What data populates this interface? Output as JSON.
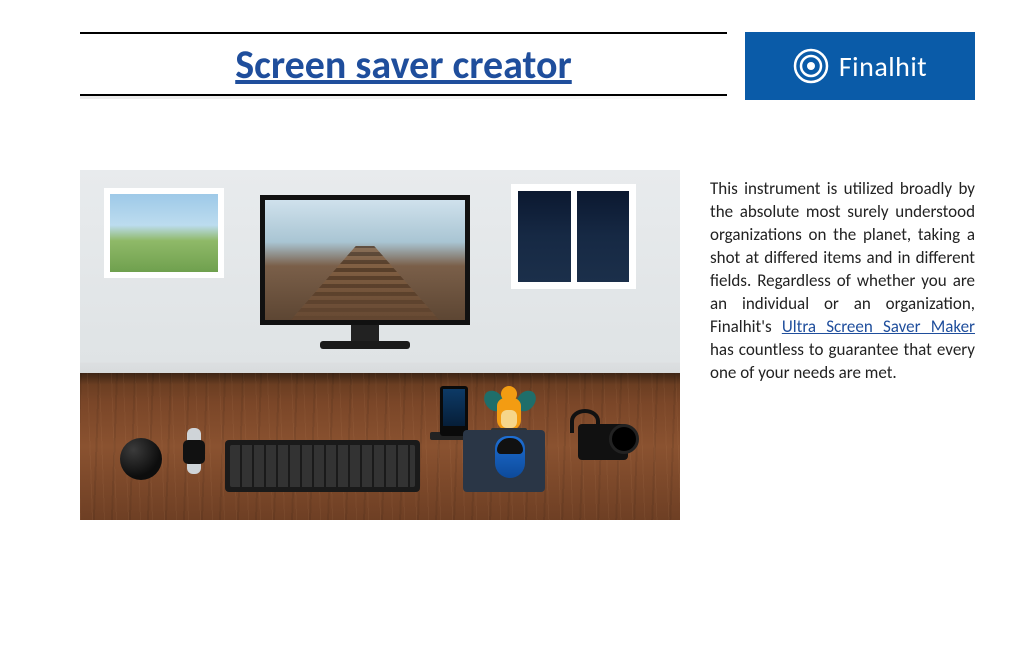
{
  "header": {
    "title": "Screen saver creator",
    "logo_text": "Finalhit"
  },
  "body": {
    "text_before_link": "This instrument is utilized broadly by the absolute most surely understood organizations on the planet, taking a shot at differed items and in different fields. Regardless of whether you are an individual or an organization, Finalhit's ",
    "link_text": "Ultra Screen Saver Maker",
    "text_after_link": " has countless to guarantee that every one of your needs are met."
  }
}
